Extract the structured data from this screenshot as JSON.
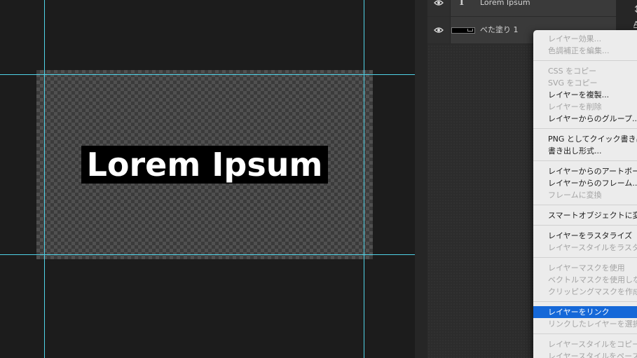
{
  "canvas": {
    "text": "Lorem Ipsum"
  },
  "layers": [
    {
      "name": "Lorem Ipsum",
      "kind": "text",
      "thumb_glyph": "T",
      "visible": true
    },
    {
      "name": "べた塗り 1",
      "kind": "fill",
      "visible": true
    }
  ],
  "context_menu": {
    "groups": [
      [
        {
          "label": "レイヤー効果...",
          "enabled": false
        },
        {
          "label": "色調補正を編集...",
          "enabled": false
        }
      ],
      [
        {
          "label": "CSS をコピー",
          "enabled": false
        },
        {
          "label": "SVG をコピー",
          "enabled": false
        },
        {
          "label": "レイヤーを複製...",
          "enabled": true
        },
        {
          "label": "レイヤーを削除",
          "enabled": false
        },
        {
          "label": "レイヤーからのグループ...",
          "enabled": true
        }
      ],
      [
        {
          "label": "PNG としてクイック書き出し",
          "enabled": true
        },
        {
          "label": "書き出し形式...",
          "enabled": true
        }
      ],
      [
        {
          "label": "レイヤーからのアートボード...",
          "enabled": true
        },
        {
          "label": "レイヤーからのフレーム...",
          "enabled": true
        },
        {
          "label": "フレームに変換",
          "enabled": false
        }
      ],
      [
        {
          "label": "スマートオブジェクトに変換",
          "enabled": true
        }
      ],
      [
        {
          "label": "レイヤーをラスタライズ",
          "enabled": true
        },
        {
          "label": "レイヤースタイルをラスタライズ",
          "enabled": false
        }
      ],
      [
        {
          "label": "レイヤーマスクを使用",
          "enabled": false
        },
        {
          "label": "ベクトルマスクを使用しない",
          "enabled": false
        },
        {
          "label": "クリッピングマスクを作成",
          "enabled": false
        }
      ],
      [
        {
          "label": "レイヤーをリンク",
          "enabled": true,
          "highlighted": true
        },
        {
          "label": "リンクしたレイヤーを選択",
          "enabled": false
        }
      ],
      [
        {
          "label": "レイヤースタイルをコピー",
          "enabled": false
        },
        {
          "label": "レイヤースタイルをペースト",
          "enabled": false
        }
      ]
    ]
  },
  "right_strip": {
    "icon": "move-vertical-arrow",
    "letter": "A"
  },
  "colors": {
    "guide": "#4fd3e8",
    "menu_highlight": "#1568d8"
  }
}
